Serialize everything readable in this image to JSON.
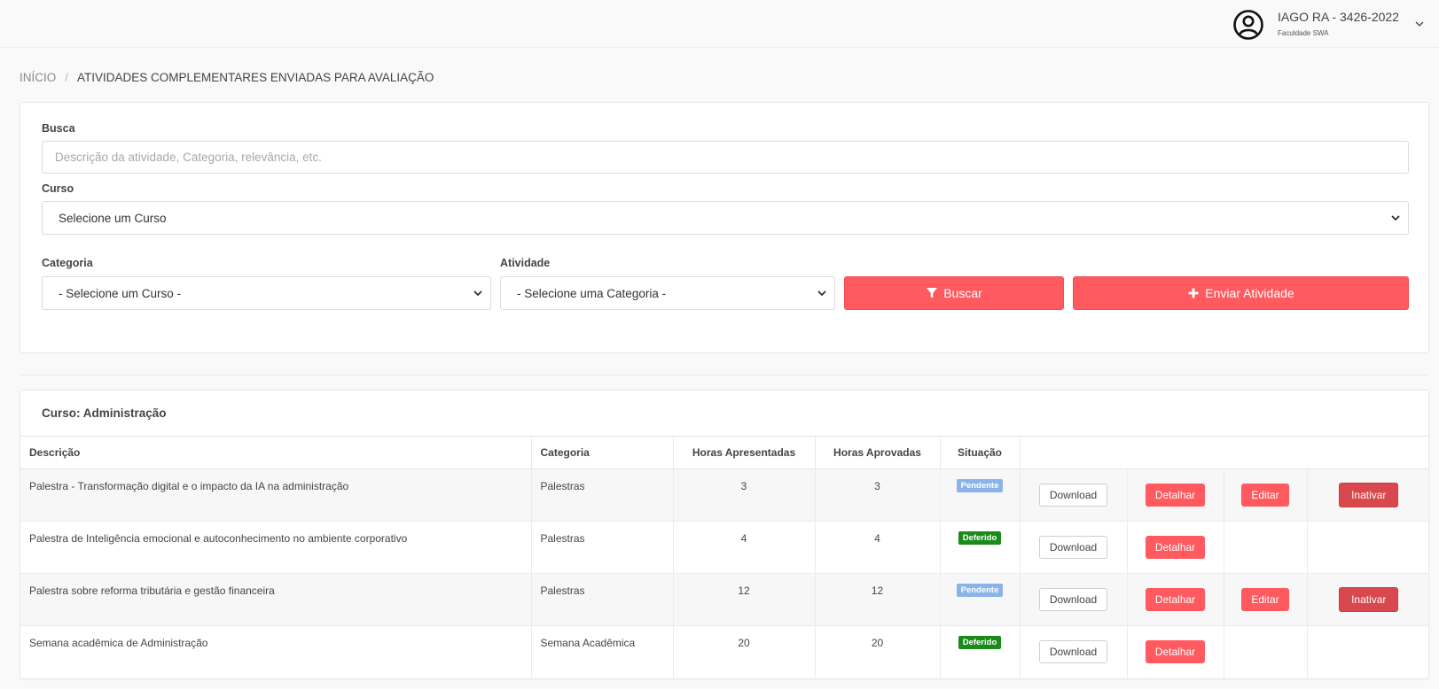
{
  "user": {
    "name": "IAGO RA - 3426-2022",
    "org": "Faculdade SWA"
  },
  "breadcrumb": {
    "home": "INÍCIO",
    "separator": "/",
    "current": "ATIVIDADES COMPLEMENTARES ENVIADAS PARA AVALIAÇÃO"
  },
  "filters": {
    "search_label": "Busca",
    "search_placeholder": "Descrição da atividade, Categoria, relevância, etc.",
    "course_label": "Curso",
    "course_value": "Selecione um Curso",
    "category_label": "Categoria",
    "category_value": "- Selecione um Curso -",
    "activity_label": "Atividade",
    "activity_value": "- Selecione uma Categoria -",
    "search_button": "Buscar",
    "send_button": "Enviar Atividade"
  },
  "table": {
    "course_title": "Curso: Administração",
    "headers": [
      "Descrição",
      "Categoria",
      "Horas Apresentadas",
      "Horas Aprovadas",
      "Situação"
    ],
    "action_labels": {
      "download": "Download",
      "detail": "Detalhar",
      "edit": "Editar",
      "deactivate": "Inativar"
    },
    "rows": [
      {
        "description": "Palestra - Transformação digital e o impacto da IA na administração",
        "category": "Palestras",
        "hours_presented": "3",
        "hours_approved": "3",
        "status": "Pendente"
      },
      {
        "description": "Palestra de Inteligência emocional e autoconhecimento no ambiente corporativo",
        "category": "Palestras",
        "hours_presented": "4",
        "hours_approved": "4",
        "status": "Deferido"
      },
      {
        "description": "Palestra sobre reforma tributária e gestão financeira",
        "category": "Palestras",
        "hours_presented": "12",
        "hours_approved": "12",
        "status": "Pendente"
      },
      {
        "description": "Semana acadêmica de Administração",
        "category": "Semana Acadêmica",
        "hours_presented": "20",
        "hours_approved": "20",
        "status": "Deferido"
      }
    ]
  },
  "colors": {
    "accent": "#ff5a5f",
    "accent_dark": "#d9484c",
    "pending": "#8ab4e8",
    "approved": "#1a8a1a"
  }
}
